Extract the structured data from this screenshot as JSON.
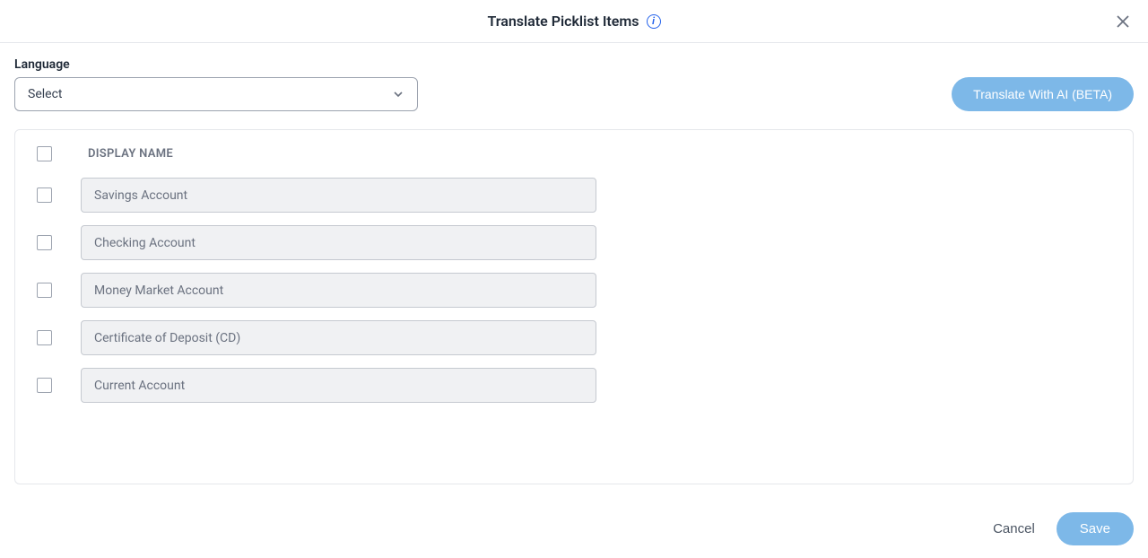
{
  "header": {
    "title": "Translate Picklist Items"
  },
  "language": {
    "label": "Language",
    "selected": "Select"
  },
  "buttons": {
    "translate_ai": "Translate With AI (BETA)",
    "cancel": "Cancel",
    "save": "Save"
  },
  "table": {
    "column_header": "DISPLAY NAME",
    "rows": [
      {
        "display_name": "Savings Account"
      },
      {
        "display_name": "Checking Account"
      },
      {
        "display_name": "Money Market Account"
      },
      {
        "display_name": "Certificate of Deposit (CD)"
      },
      {
        "display_name": "Current Account"
      }
    ]
  }
}
